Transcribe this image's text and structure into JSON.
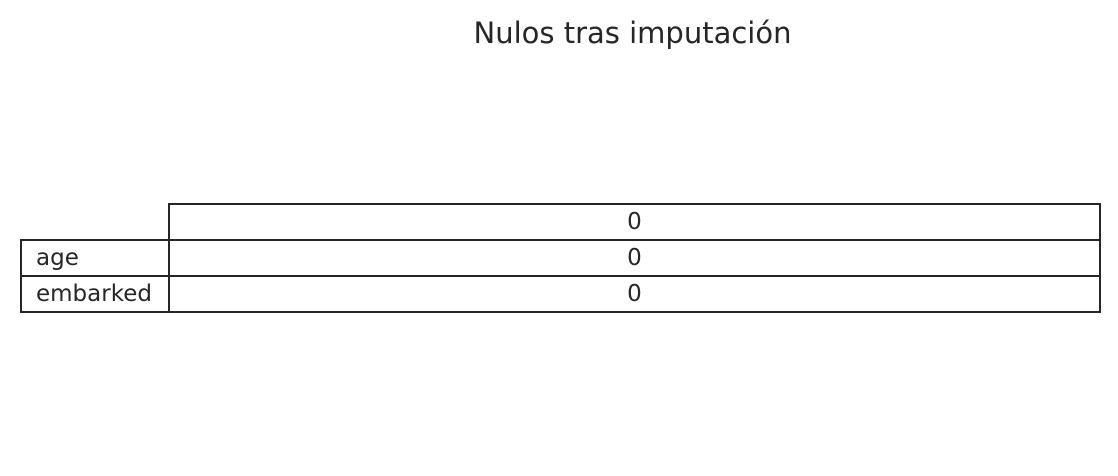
{
  "chart_data": {
    "type": "table",
    "title": "Nulos tras imputación",
    "column_headers": [
      "0"
    ],
    "rows": [
      {
        "label": "age",
        "values": [
          "0"
        ]
      },
      {
        "label": "embarked",
        "values": [
          "0"
        ]
      }
    ]
  }
}
